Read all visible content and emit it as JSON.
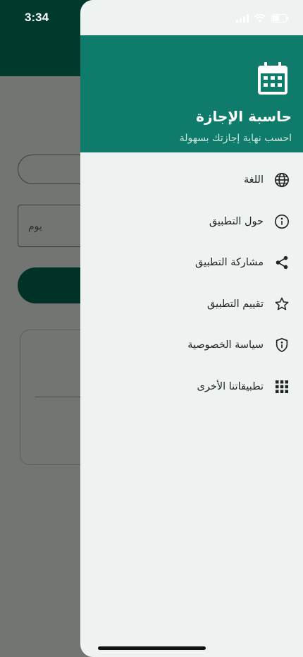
{
  "status_bar": {
    "time": "3:34"
  },
  "background": {
    "day_field_value": "يوم"
  },
  "drawer": {
    "title": "حاسبة الإجازة",
    "subtitle": "احسب نهاية إجازتك بسهولة",
    "menu": [
      {
        "label": "اللغة",
        "icon": "globe-icon"
      },
      {
        "label": "حول التطبيق",
        "icon": "info-icon"
      },
      {
        "label": "مشاركة التطبيق",
        "icon": "share-icon"
      },
      {
        "label": "تقييم التطبيق",
        "icon": "star-icon"
      },
      {
        "label": "سياسة الخصوصية",
        "icon": "shield-icon"
      },
      {
        "label": "تطبيقاتنا الأخرى",
        "icon": "apps-grid-icon"
      }
    ]
  },
  "colors": {
    "drawer_header": "#0f7c6b",
    "drawer_bg": "#eef3f1",
    "app_header": "#003a2c",
    "overlay": "#737573"
  }
}
